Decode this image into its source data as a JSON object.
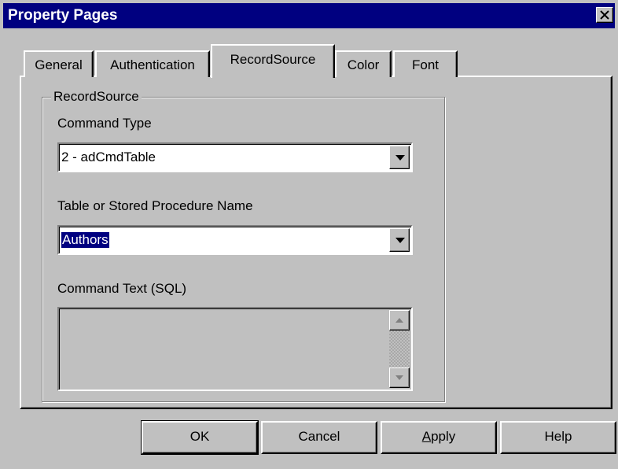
{
  "window": {
    "title": "Property Pages",
    "close_icon": "close-icon"
  },
  "tabs": [
    {
      "label": "General",
      "active": false
    },
    {
      "label": "Authentication",
      "active": false
    },
    {
      "label": "RecordSource",
      "active": true
    },
    {
      "label": "Color",
      "active": false
    },
    {
      "label": "Font",
      "active": false
    }
  ],
  "recordsource": {
    "group_label": "RecordSource",
    "command_type": {
      "label": "Command Type",
      "value": "2 - adCmdTable"
    },
    "table_name": {
      "label": "Table or Stored Procedure Name",
      "value": "Authors",
      "selected": true
    },
    "command_text": {
      "label": "Command Text (SQL)",
      "value": "",
      "enabled": false
    }
  },
  "buttons": {
    "ok": "OK",
    "cancel": "Cancel",
    "apply_mnemonic": "A",
    "apply_rest": "pply",
    "help": "Help"
  },
  "colors": {
    "titlebar": "#000080",
    "face": "#c0c0c0",
    "selection": "#000080"
  }
}
